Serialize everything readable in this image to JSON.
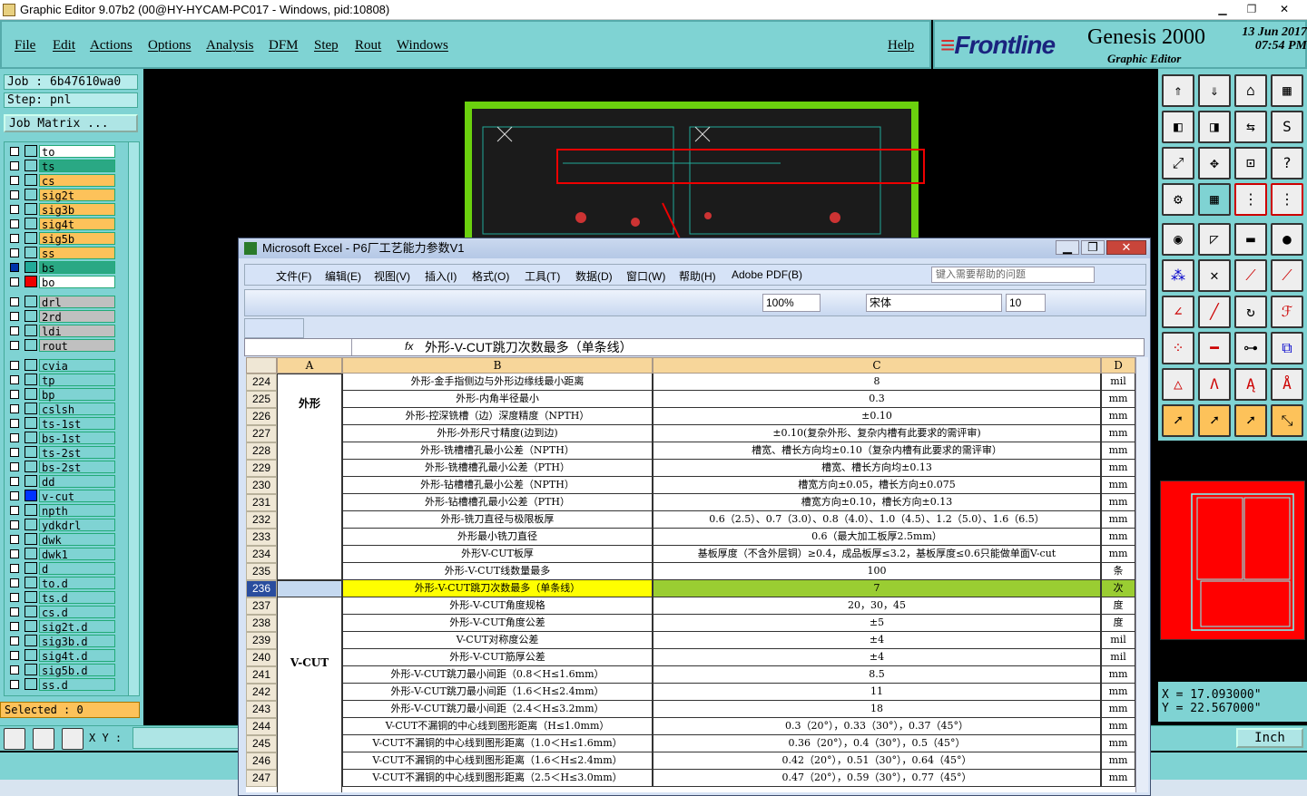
{
  "window_title": "Graphic Editor 9.07b2 (00@HY-HYCAM-PC017 - Windows, pid:10808)",
  "menu": [
    "File",
    "Edit",
    "Actions",
    "Options",
    "Analysis",
    "DFM",
    "Step",
    "Rout",
    "Windows"
  ],
  "help_label": "Help",
  "brand": {
    "frontline": "Frontline",
    "product": "Genesis 2000",
    "subtitle": "Graphic Editor",
    "date": "13 Jun 2017",
    "time": "07:54 PM"
  },
  "job": "Job : 6b47610wa0",
  "step": "Step: pnl",
  "job_matrix": "Job Matrix ...",
  "layers": [
    {
      "name": "to",
      "color": "#ffffff"
    },
    {
      "name": "ts",
      "color": "#2aa884"
    },
    {
      "name": "cs",
      "color": "#fdc25a"
    },
    {
      "name": "sig2t",
      "color": "#fdc25a"
    },
    {
      "name": "sig3b",
      "color": "#fdc25a"
    },
    {
      "name": "sig4t",
      "color": "#fdc25a"
    },
    {
      "name": "sig5b",
      "color": "#fdc25a"
    },
    {
      "name": "ss",
      "color": "#fdc25a"
    },
    {
      "name": "bs",
      "color": "#2aa884"
    },
    {
      "name": "bo",
      "color": "#ffffff"
    },
    {
      "name": "drl",
      "color": "#c0c0c0"
    },
    {
      "name": "2rd",
      "color": "#c0c0c0"
    },
    {
      "name": "ldi",
      "color": "#c0c0c0"
    },
    {
      "name": "rout",
      "color": "#c0c0c0"
    },
    {
      "name": "cvia",
      "color": "#7fd3d3"
    },
    {
      "name": "tp",
      "color": "#7fd3d3"
    },
    {
      "name": "bp",
      "color": "#7fd3d3"
    },
    {
      "name": "cslsh",
      "color": "#7fd3d3"
    },
    {
      "name": "ts-1st",
      "color": "#7fd3d3"
    },
    {
      "name": "bs-1st",
      "color": "#7fd3d3"
    },
    {
      "name": "ts-2st",
      "color": "#7fd3d3"
    },
    {
      "name": "bs-2st",
      "color": "#7fd3d3"
    },
    {
      "name": "dd",
      "color": "#7fd3d3"
    },
    {
      "name": "v-cut",
      "color": "#7fd3d3"
    },
    {
      "name": "npth",
      "color": "#7fd3d3"
    },
    {
      "name": "ydkdrl",
      "color": "#7fd3d3"
    },
    {
      "name": "dwk",
      "color": "#7fd3d3"
    },
    {
      "name": "dwk1",
      "color": "#7fd3d3"
    },
    {
      "name": "d",
      "color": "#7fd3d3"
    },
    {
      "name": "to.d",
      "color": "#7fd3d3"
    },
    {
      "name": "ts.d",
      "color": "#7fd3d3"
    },
    {
      "name": "cs.d",
      "color": "#7fd3d3"
    },
    {
      "name": "sig2t.d",
      "color": "#7fd3d3"
    },
    {
      "name": "sig3b.d",
      "color": "#7fd3d3"
    },
    {
      "name": "sig4t.d",
      "color": "#7fd3d3"
    },
    {
      "name": "sig5b.d",
      "color": "#7fd3d3"
    },
    {
      "name": "ss.d",
      "color": "#7fd3d3"
    }
  ],
  "selected": "Selected : 0",
  "xy_label": "X Y :",
  "coords": {
    "x": "X = 17.093000\"",
    "y": "Y = 22.567000\""
  },
  "units": "Inch",
  "excel": {
    "title": "Microsoft Excel - P6厂工艺能力参数V1",
    "menus": [
      "文件(F)",
      "编辑(E)",
      "视图(V)",
      "插入(I)",
      "格式(O)",
      "工具(T)",
      "数据(D)",
      "窗口(W)",
      "帮助(H)",
      "Adobe PDF(B)"
    ],
    "help_placeholder": "键入需要帮助的问题",
    "zoom": "100%",
    "font": "宋体",
    "font_size": "10",
    "formula": "外形-V-CUT跳刀次数最多（单条线）",
    "columns": [
      "A",
      "B",
      "C",
      "D"
    ],
    "group_a1": "外形",
    "group_a2": "V-CUT",
    "rows": [
      {
        "n": "224",
        "b": "外形-金手指侧边与外形边缘线最小距离",
        "c": "8",
        "d": "mil"
      },
      {
        "n": "225",
        "b": "外形-内角半径最小",
        "c": "0.3",
        "d": "mm"
      },
      {
        "n": "226",
        "b": "外形-控深铣槽（边）深度精度（NPTH）",
        "c": "±0.10",
        "d": "mm"
      },
      {
        "n": "227",
        "b": "外形-外形尺寸精度(边到边)",
        "c": "±0.10(复杂外形、复杂内槽有此要求的需评审)",
        "d": "mm"
      },
      {
        "n": "228",
        "b": "外形-铣槽槽孔最小公差（NPTH）",
        "c": "槽宽、槽长方向均±0.10（复杂内槽有此要求的需评审）",
        "d": "mm"
      },
      {
        "n": "229",
        "b": "外形-铣槽槽孔最小公差（PTH）",
        "c": "槽宽、槽长方向均±0.13",
        "d": "mm"
      },
      {
        "n": "230",
        "b": "外形-钻槽槽孔最小公差（NPTH）",
        "c": "槽宽方向±0.05，槽长方向±0.075",
        "d": "mm"
      },
      {
        "n": "231",
        "b": "外形-钻槽槽孔最小公差（PTH）",
        "c": "槽宽方向±0.10，槽长方向±0.13",
        "d": "mm"
      },
      {
        "n": "232",
        "b": "外形-铣刀直径与极限板厚",
        "c": "0.6（2.5）、0.7（3.0）、0.8（4.0）、1.0（4.5）、1.2（5.0）、1.6（6.5）",
        "d": "mm"
      },
      {
        "n": "233",
        "b": "外形最小铣刀直径",
        "c": "0.6（最大加工板厚2.5mm）",
        "d": "mm"
      },
      {
        "n": "234",
        "b": "外形V-CUT板厚",
        "c": "基板厚度（不含外层铜）≥0.4，成品板厚≤3.2，基板厚度≤0.6只能做单面V-cut",
        "d": "mm"
      },
      {
        "n": "235",
        "b": "外形-V-CUT线数量最多",
        "c": "100",
        "d": "条"
      },
      {
        "n": "236",
        "b": "外形-V-CUT跳刀次数最多（单条线）",
        "c": "7",
        "d": "次"
      },
      {
        "n": "237",
        "b": "外形-V-CUT角度规格",
        "c": "20，30，45",
        "d": "度"
      },
      {
        "n": "238",
        "b": "外形-V-CUT角度公差",
        "c": "±5",
        "d": "度"
      },
      {
        "n": "239",
        "b": "V-CUT对称度公差",
        "c": "±4",
        "d": "mil"
      },
      {
        "n": "240",
        "b": "外形-V-CUT筋厚公差",
        "c": "±4",
        "d": "mil"
      },
      {
        "n": "241",
        "b": "外形-V-CUT跳刀最小间距（0.8＜H≤1.6mm）",
        "c": "8.5",
        "d": "mm"
      },
      {
        "n": "242",
        "b": "外形-V-CUT跳刀最小间距（1.6＜H≤2.4mm）",
        "c": "11",
        "d": "mm"
      },
      {
        "n": "243",
        "b": "外形-V-CUT跳刀最小间距（2.4＜H≤3.2mm）",
        "c": "18",
        "d": "mm"
      },
      {
        "n": "244",
        "b": "V-CUT不漏铜的中心线到图形距离（H≤1.0mm）",
        "c": "0.3（20°），0.33（30°），0.37（45°）",
        "d": "mm"
      },
      {
        "n": "245",
        "b": "V-CUT不漏铜的中心线到图形距离（1.0＜H≤1.6mm）",
        "c": "0.36（20°），0.4（30°），0.5（45°）",
        "d": "mm"
      },
      {
        "n": "246",
        "b": "V-CUT不漏铜的中心线到图形距离（1.6＜H≤2.4mm）",
        "c": "0.42（20°），0.51（30°），0.64（45°）",
        "d": "mm"
      },
      {
        "n": "247",
        "b": "V-CUT不漏铜的中心线到图形距离（2.5＜H≤3.0mm）",
        "c": "0.47（20°），0.59（30°），0.77（45°）",
        "d": "mm"
      }
    ]
  }
}
